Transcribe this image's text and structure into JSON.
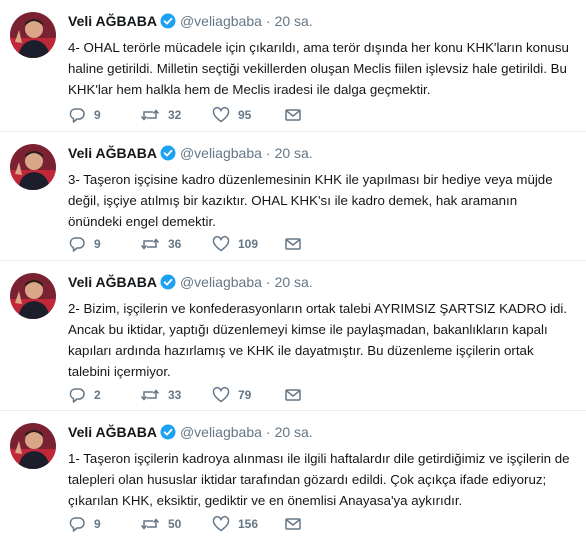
{
  "tweets": [
    {
      "name": "Veli AĞBABA",
      "handle": "@veliagbaba",
      "separator": "·",
      "time": "20 sa.",
      "text": "4- OHAL terörle mücadele için çıkarıldı, ama terör dışında her konu KHK'ların konusu haline getirildi. Milletin seçtiği vekillerden oluşan Meclis fiilen işlevsiz hale getirildi. Bu KHK'lar hem halkla hem de Meclis iradesi ile dalga geçmektir.",
      "replies": "9",
      "retweets": "32",
      "likes": "95"
    },
    {
      "name": "Veli AĞBABA",
      "handle": "@veliagbaba",
      "separator": "·",
      "time": "20 sa.",
      "text": "3- Taşeron işçisine kadro düzenlemesinin KHK ile yapılması bir hediye veya müjde değil, işçiye atılmış bir kazıktır. OHAL KHK'sı ile kadro demek, hak aramanın önündeki engel demektir.",
      "replies": "9",
      "retweets": "36",
      "likes": "109"
    },
    {
      "name": "Veli AĞBABA",
      "handle": "@veliagbaba",
      "separator": "·",
      "time": "20 sa.",
      "text": "2- Bizim, işçilerin ve konfederasyonların ortak talebi AYRIMSIZ ŞARTSIZ KADRO idi. Ancak bu iktidar, yaptığı düzenlemeyi kimse ile paylaşmadan, bakanlıkların kapalı kapıları ardında hazırlamış ve KHK ile dayatmıştır. Bu düzenleme işçilerin ortak talebini içermiyor.",
      "replies": "2",
      "retweets": "33",
      "likes": "79"
    },
    {
      "name": "Veli AĞBABA",
      "handle": "@veliagbaba",
      "separator": "·",
      "time": "20 sa.",
      "text": "1- Taşeron işçilerin kadroya alınması ile ilgili haftalardır dile getirdiğimiz ve işçilerin de talepleri olan hususlar iktidar tarafından gözardı edildi. Çok açıkça ifade ediyoruz; çıkarılan KHK, eksiktir, gediktir ve en önemlisi Anayasa'ya aykırıdır.",
      "replies": "9",
      "retweets": "50",
      "likes": "156"
    }
  ],
  "colors": {
    "text": "#14171a",
    "muted": "#657786",
    "verified": "#1da1f2",
    "divider": "#e6ecf0"
  },
  "icons": {
    "reply": "reply-icon",
    "retweet": "retweet-icon",
    "like": "heart-icon",
    "dm": "envelope-icon",
    "verified": "verified-badge-icon"
  }
}
